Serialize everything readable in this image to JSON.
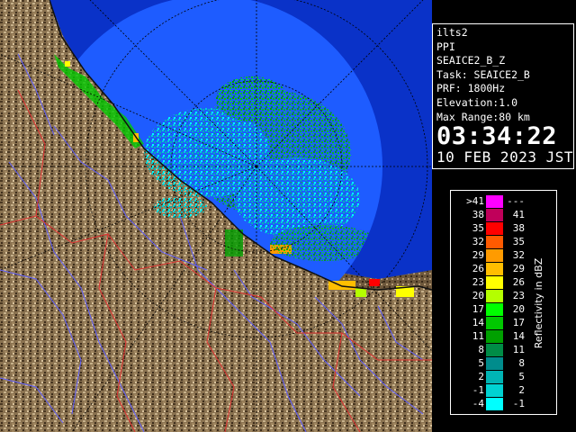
{
  "info": {
    "site": "ilts2",
    "product": "PPI",
    "task_name": "SEAICE2_B_Z",
    "task": "Task: SEAICE2_B",
    "prf": "PRF: 1800Hz",
    "elevation": "Elevation:1.0",
    "max_range": "Max Range:80 km",
    "time": "03:34:22",
    "date": "10 FEB 2023 JST"
  },
  "legend": {
    "title": "Reflectivity in dBZ",
    "rows": [
      {
        "lo": ">41",
        "hi": "---",
        "color": "#ff00ff"
      },
      {
        "lo": "38",
        "hi": "41",
        "color": "#c0005a"
      },
      {
        "lo": "35",
        "hi": "38",
        "color": "#ff0000"
      },
      {
        "lo": "32",
        "hi": "35",
        "color": "#ff5a00"
      },
      {
        "lo": "29",
        "hi": "32",
        "color": "#ff9b00"
      },
      {
        "lo": "26",
        "hi": "29",
        "color": "#ffbe00"
      },
      {
        "lo": "23",
        "hi": "26",
        "color": "#ffff00"
      },
      {
        "lo": "20",
        "hi": "23",
        "color": "#b4ff00"
      },
      {
        "lo": "17",
        "hi": "20",
        "color": "#00ff00"
      },
      {
        "lo": "14",
        "hi": "17",
        "color": "#00c800"
      },
      {
        "lo": "11",
        "hi": "14",
        "color": "#00a000"
      },
      {
        "lo": "8",
        "hi": "11",
        "color": "#008c46"
      },
      {
        "lo": "5",
        "hi": "8",
        "color": "#008c8c"
      },
      {
        "lo": "2",
        "hi": "5",
        "color": "#00b4b4"
      },
      {
        "lo": "-1",
        "hi": "2",
        "color": "#00d2d2"
      },
      {
        "lo": "-4",
        "hi": "-1",
        "color": "#00ffff"
      }
    ]
  },
  "colors": {
    "sea": "#1e5cff",
    "sea_deep": "#0a32c8",
    "land": "#7a6448",
    "land_dark": "#5a4530",
    "rivers": "#6060ff",
    "borders": "#e03030"
  }
}
